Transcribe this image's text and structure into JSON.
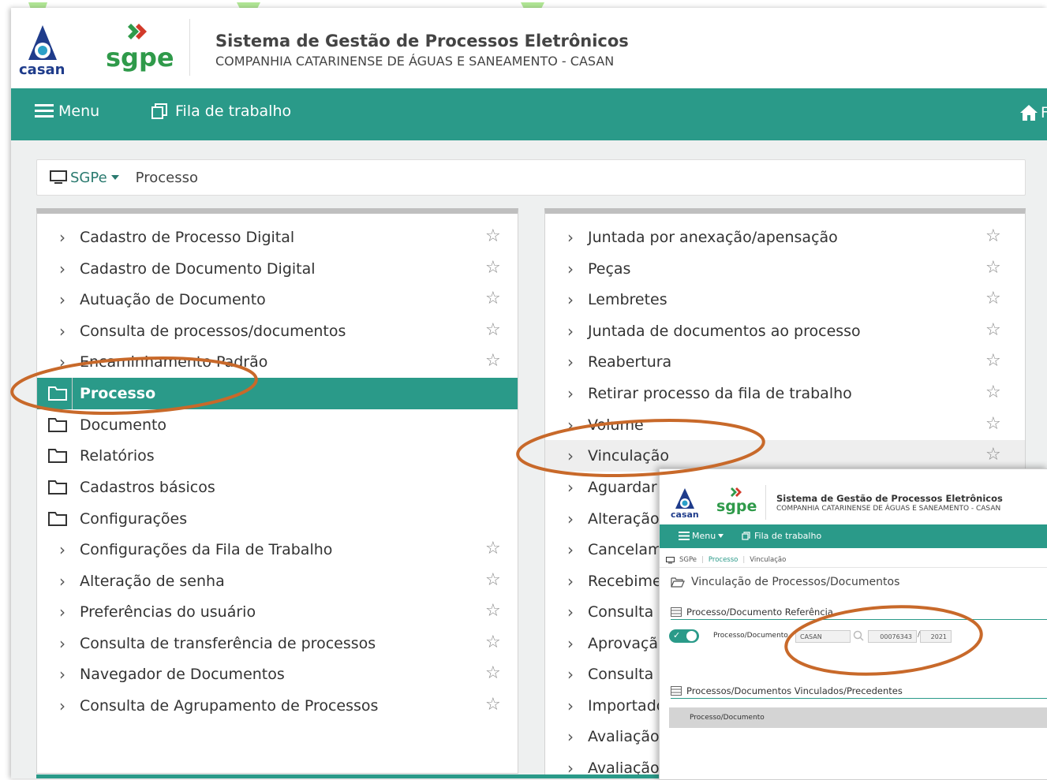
{
  "header": {
    "logo_casan_text": "casan",
    "logo_sgpe_text": "sgpe",
    "title": "Sistema de Gestão de Processos Eletrônicos",
    "subtitle": "COMPANHIA CATARINENSE DE ÁGUAS E SANEAMENTO - CASAN"
  },
  "topbar": {
    "menu_label": "Menu",
    "fila_label": "Fila de trabalho",
    "home_label_partial": "F"
  },
  "breadcrumb": {
    "root": "SGPe",
    "current": "Processo"
  },
  "left_panel": {
    "items": [
      {
        "type": "item",
        "label": "Cadastro de Processo Digital",
        "starred": false
      },
      {
        "type": "item",
        "label": "Cadastro de Documento Digital",
        "starred": false
      },
      {
        "type": "item",
        "label": "Autuação de Documento",
        "starred": false
      },
      {
        "type": "item",
        "label": "Consulta de processos/documentos",
        "starred": false
      },
      {
        "type": "item",
        "label": "Encaminhamento Padrão",
        "starred": false
      },
      {
        "type": "folder",
        "label": "Processo",
        "active": true
      },
      {
        "type": "folder",
        "label": "Documento"
      },
      {
        "type": "folder",
        "label": "Relatórios"
      },
      {
        "type": "folder",
        "label": "Cadastros básicos"
      },
      {
        "type": "folder",
        "label": "Configurações"
      },
      {
        "type": "item",
        "label": "Configurações da Fila de Trabalho",
        "starred": false
      },
      {
        "type": "item",
        "label": "Alteração de senha",
        "starred": false
      },
      {
        "type": "item",
        "label": "Preferências do usuário",
        "starred": false
      },
      {
        "type": "item",
        "label": "Consulta de transferência de processos",
        "starred": false
      },
      {
        "type": "item",
        "label": "Navegador de Documentos",
        "starred": false
      },
      {
        "type": "item",
        "label": "Consulta de Agrupamento de Processos",
        "starred": false
      }
    ]
  },
  "right_panel": {
    "items": [
      {
        "label": "Juntada por anexação/apensação"
      },
      {
        "label": "Peças"
      },
      {
        "label": "Lembretes"
      },
      {
        "label": "Juntada de documentos ao processo"
      },
      {
        "label": "Reabertura"
      },
      {
        "label": "Retirar processo da fila de trabalho"
      },
      {
        "label": "Volume"
      },
      {
        "label": "Vinculação",
        "highlighted": true
      },
      {
        "label": "Aguardar Prazo"
      },
      {
        "label": "Alteração"
      },
      {
        "label": "Cancelam"
      },
      {
        "label": "Recebime"
      },
      {
        "label": "Consulta"
      },
      {
        "label": "Aprovaçã"
      },
      {
        "label": "Consulta"
      },
      {
        "label": "Importado"
      },
      {
        "label": "Avaliação"
      },
      {
        "label": "Avaliação"
      }
    ]
  },
  "inset": {
    "title": "Sistema de Gestão de Processos Eletrônicos",
    "subtitle": "COMPANHIA CATARINENSE DE ÁGUAS E SANEAMENTO - CASAN",
    "menu_label": "Menu",
    "fila_label": "Fila de trabalho",
    "breadcrumb": [
      "SGPe",
      "Processo",
      "Vinculação"
    ],
    "page_title": "Vinculação de Processos/Documentos",
    "section1": "Processo/Documento Referência",
    "field_label": "Processo/Documento",
    "field_org": "CASAN",
    "field_number": "00076343",
    "field_year": "2021",
    "section2": "Processos/Documentos Vinculados/Precedentes",
    "table_header": "Processo/Documento"
  },
  "colors": {
    "primary": "#2a9a89",
    "annotation": "#c8692a"
  }
}
